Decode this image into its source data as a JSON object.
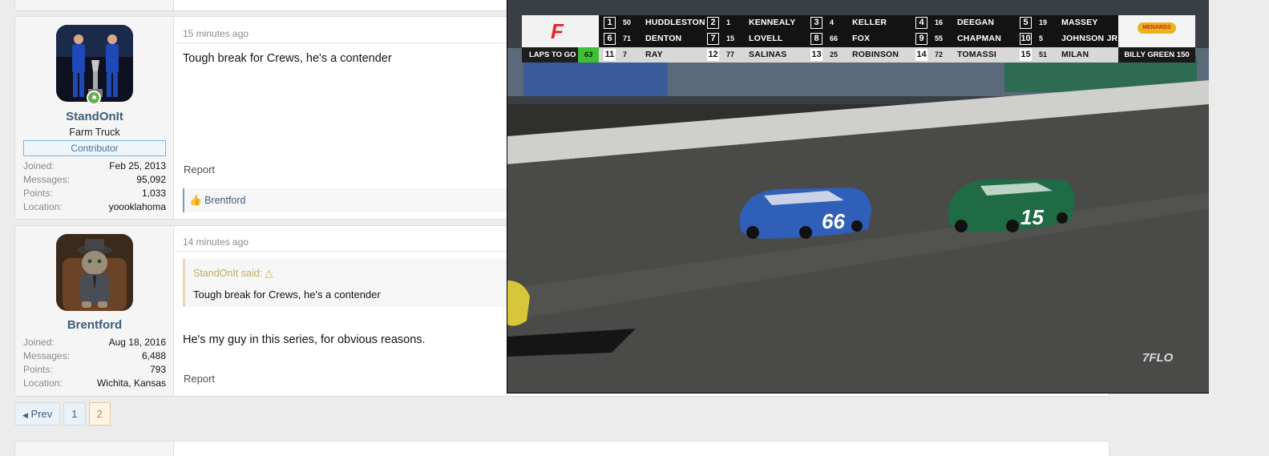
{
  "posts": [
    {
      "username": "StandOnIt",
      "user_title": "Farm Truck",
      "banner": "Contributor",
      "stats": [
        {
          "label": "Joined:",
          "value": "Feb 25, 2013"
        },
        {
          "label": "Messages:",
          "value": "95,092"
        },
        {
          "label": "Points:",
          "value": "1,033"
        },
        {
          "label": "Location:",
          "value": "yoooklahoma"
        }
      ],
      "time": "15 minutes ago",
      "body": "Tough break for Crews, he's a contender",
      "report": "Report",
      "reaction_user": "Brentford"
    },
    {
      "username": "Brentford",
      "stats": [
        {
          "label": "Joined:",
          "value": "Aug 18, 2016"
        },
        {
          "label": "Messages:",
          "value": "6,488"
        },
        {
          "label": "Points:",
          "value": "793"
        },
        {
          "label": "Location:",
          "value": "Wichita, Kansas"
        }
      ],
      "time": "14 minutes ago",
      "quote_author": "StandOnIt said:",
      "quote_text": "Tough break for Crews, he's a contender",
      "body": "He's my guy in this series, for obvious reasons.",
      "report": "Report"
    }
  ],
  "pager": {
    "prev": "Prev",
    "pages": [
      "1",
      "2"
    ],
    "current": "2"
  },
  "video": {
    "laps_label": "LAPS TO GO",
    "laps_value": "63",
    "race_name": "BILLY GREEN 150",
    "sponsor": "MENARDS",
    "watermark": "FLO",
    "leaderboard": [
      {
        "pos": "1",
        "num": "50",
        "name": "HUDDLESTON"
      },
      {
        "pos": "2",
        "num": "1",
        "name": "KENNEALY"
      },
      {
        "pos": "3",
        "num": "4",
        "name": "KELLER"
      },
      {
        "pos": "4",
        "num": "16",
        "name": "DEEGAN"
      },
      {
        "pos": "5",
        "num": "19",
        "name": "MASSEY"
      },
      {
        "pos": "6",
        "num": "71",
        "name": "DENTON"
      },
      {
        "pos": "7",
        "num": "15",
        "name": "LOVELL"
      },
      {
        "pos": "8",
        "num": "66",
        "name": "FOX"
      },
      {
        "pos": "9",
        "num": "55",
        "name": "CHAPMAN"
      },
      {
        "pos": "10",
        "num": "5",
        "name": "JOHNSON JR"
      },
      {
        "pos": "11",
        "num": "7",
        "name": "RAY"
      },
      {
        "pos": "12",
        "num": "77",
        "name": "SALINAS"
      },
      {
        "pos": "13",
        "num": "25",
        "name": "ROBINSON"
      },
      {
        "pos": "14",
        "num": "72",
        "name": "TOMASSI"
      },
      {
        "pos": "15",
        "num": "51",
        "name": "MILAN"
      }
    ],
    "cars": [
      {
        "number": "66",
        "color": "#2f5fb8"
      },
      {
        "number": "15",
        "color": "#1f6b45"
      }
    ]
  },
  "colors": {
    "accent": "#3f5e7b",
    "online": "#63b14f",
    "laps_green": "#3fbf34",
    "flo_red": "#e5262b"
  }
}
